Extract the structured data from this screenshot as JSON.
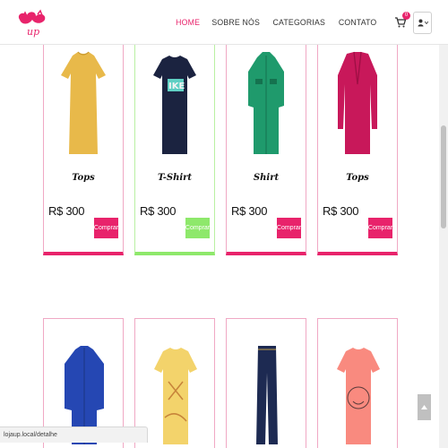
{
  "header": {
    "nav": [
      {
        "label": "HOME",
        "active": true
      },
      {
        "label": "SOBRE NÓS",
        "active": false
      },
      {
        "label": "CATEGORIAS",
        "active": false
      },
      {
        "label": "CONTATO",
        "active": false
      }
    ],
    "cart_count": "0"
  },
  "products_row1": [
    {
      "name": "Tops",
      "price": "R$ 300",
      "button": "Comprar",
      "color": "#e8b94a"
    },
    {
      "name": "T-Shirt",
      "price": "R$ 300",
      "button": "Comprar",
      "color": "#1b2340"
    },
    {
      "name": "Shirt",
      "price": "R$ 300",
      "button": "Comprar",
      "color": "#1f9a6c"
    },
    {
      "name": "Tops",
      "price": "R$ 300",
      "button": "Comprar",
      "color": "#c8185a"
    }
  ],
  "products_row2": [
    {
      "color": "#2547b3"
    },
    {
      "color": "#f3d36b"
    },
    {
      "color": "#1d2a52"
    },
    {
      "color": "#f98a7f"
    }
  ],
  "status_bar": {
    "url": "lojaup.local/detalhe"
  },
  "colors": {
    "accent": "#e8236b",
    "green": "#8ee86b"
  }
}
